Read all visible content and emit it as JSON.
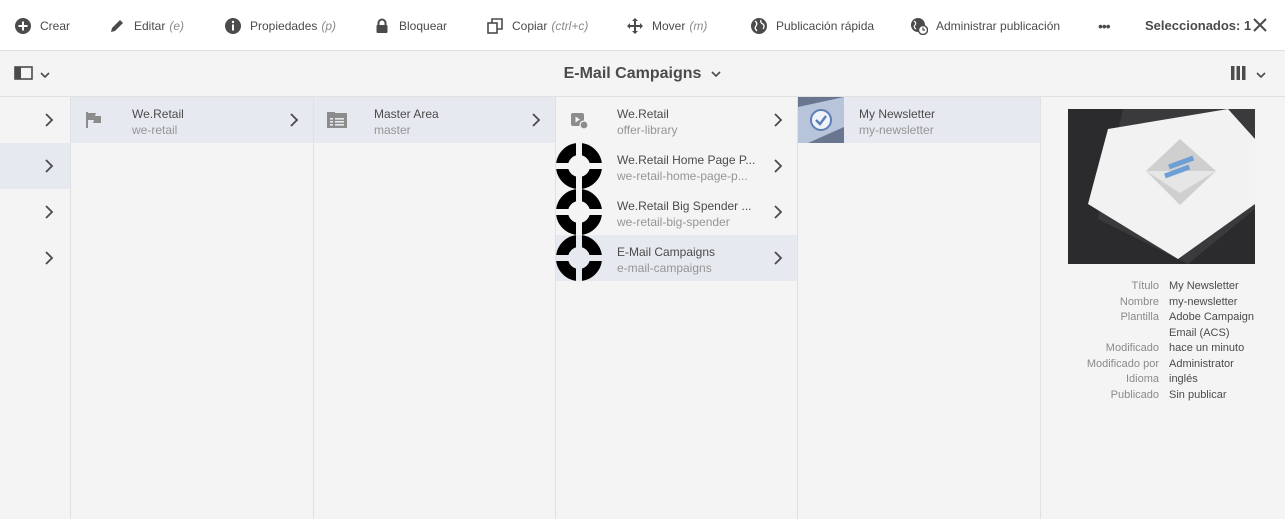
{
  "toolbar": {
    "create": "Crear",
    "edit": "Editar",
    "edit_shortcut": "(e)",
    "properties": "Propiedades",
    "properties_shortcut": "(p)",
    "lock": "Bloquear",
    "copy": "Copiar",
    "copy_shortcut": "(ctrl+c)",
    "move": "Mover",
    "move_shortcut": "(m)",
    "quick_publish": "Publicación rápida",
    "manage_publication": "Administrar publicación",
    "more": "•••",
    "selected": "Seleccionados: 1"
  },
  "header": {
    "title": "E-Mail Campaigns"
  },
  "columns": [
    {
      "items": [
        {
          "title": "We.Retail",
          "name": "we-retail",
          "active": true
        }
      ]
    },
    {
      "items": [
        {
          "title": "Master Area",
          "name": "master",
          "active": true
        }
      ]
    },
    {
      "items": [
        {
          "title": "We.Retail",
          "name": "offer-library",
          "active": false
        },
        {
          "title": "We.Retail Home Page P...",
          "name": "we-retail-home-page-p...",
          "active": false
        },
        {
          "title": "We.Retail Big Spender ...",
          "name": "we-retail-big-spender",
          "active": false
        },
        {
          "title": "E-Mail Campaigns",
          "name": "e-mail-campaigns",
          "active": true
        }
      ]
    },
    {
      "items": [
        {
          "title": "My Newsletter",
          "name": "my-newsletter",
          "active": true
        }
      ]
    }
  ],
  "details": {
    "labels": {
      "title": "Título",
      "name": "Nombre",
      "template": "Plantilla",
      "modified": "Modificado",
      "modified_by": "Modificado por",
      "language": "Idioma",
      "published": "Publicado"
    },
    "values": {
      "title": "My Newsletter",
      "name": "my-newsletter",
      "template_line1": "Adobe Campaign",
      "template_line2": "Email (ACS)",
      "modified": "hace un minuto",
      "modified_by": "Administrator",
      "language": "inglés",
      "published": "Sin publicar"
    }
  },
  "colors": {
    "active_row": "#e6e9ef",
    "background": "#f4f4f4",
    "toolbar": "#ffffff"
  },
  "icons": [
    "add-circle-icon",
    "pencil-icon",
    "info-icon",
    "lock-icon",
    "copy-icon",
    "move-icon",
    "globe-icon",
    "globe-clock-icon",
    "more-icon",
    "close-icon",
    "rail-icon",
    "chevron-down-icon",
    "column-view-icon",
    "chevron-right-icon",
    "flag-icon",
    "folder-list-icon",
    "offer-icon",
    "target-ring-icon",
    "check-circle-icon"
  ]
}
